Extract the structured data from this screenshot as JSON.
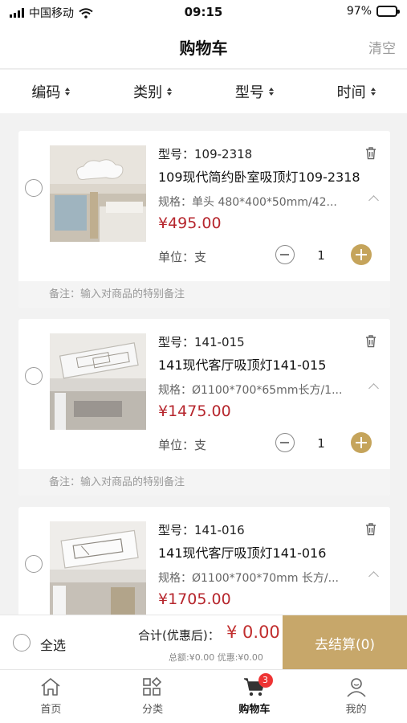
{
  "status_bar": {
    "carrier": "中国移动",
    "time": "09:15",
    "battery": "97%"
  },
  "nav": {
    "title": "购物车",
    "clear": "清空"
  },
  "sort": [
    "编码",
    "类别",
    "型号",
    "时间"
  ],
  "items": [
    {
      "model": "型号：109-2318",
      "name": "109现代简约卧室吸顶灯109-2318",
      "spec": "规格：单头 480*400*50mm/42...",
      "price": "¥495.00",
      "unit": "单位：支",
      "qty": "1",
      "remark": "备注：输入对商品的特别备注"
    },
    {
      "model": "型号：141-015",
      "name": "141现代客厅吸顶灯141-015",
      "spec": "规格：Ø1100*700*65mm长方/1...",
      "price": "¥1475.00",
      "unit": "单位：支",
      "qty": "1",
      "remark": "备注：输入对商品的特别备注"
    },
    {
      "model": "型号：141-016",
      "name": "141现代客厅吸顶灯141-016",
      "spec": "规格：Ø1100*700*70mm 长方/...",
      "price": "¥1705.00"
    }
  ],
  "checkout": {
    "select_all": "全选",
    "total_label": "合计(优惠后)：",
    "total_value": "¥ 0.00",
    "sub": "总额:¥0.00 优惠:¥0.00",
    "pay_button": "去结算(0)"
  },
  "tabbar": [
    {
      "label": "首页",
      "icon": "home-icon"
    },
    {
      "label": "分类",
      "icon": "category-icon"
    },
    {
      "label": "购物车",
      "icon": "cart-icon",
      "badge": "3"
    },
    {
      "label": "我的",
      "icon": "user-icon"
    }
  ],
  "colors": {
    "accent_gold": "#c5a45b",
    "price_red": "#b6262d"
  }
}
